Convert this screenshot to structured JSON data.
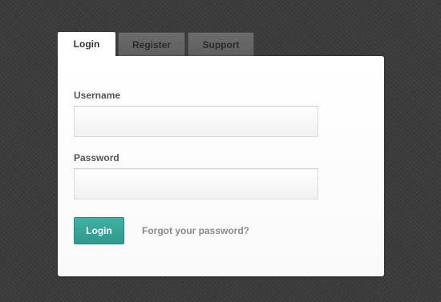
{
  "tabs": [
    {
      "label": "Login",
      "active": true
    },
    {
      "label": "Register",
      "active": false
    },
    {
      "label": "Support",
      "active": false
    }
  ],
  "form": {
    "username_label": "Username",
    "username_value": "",
    "password_label": "Password",
    "password_value": "",
    "submit_label": "Login",
    "forgot_link": "Forgot your password?"
  },
  "colors": {
    "accent": "#35a396",
    "background": "#3b3b3b",
    "panel": "#ffffff"
  }
}
